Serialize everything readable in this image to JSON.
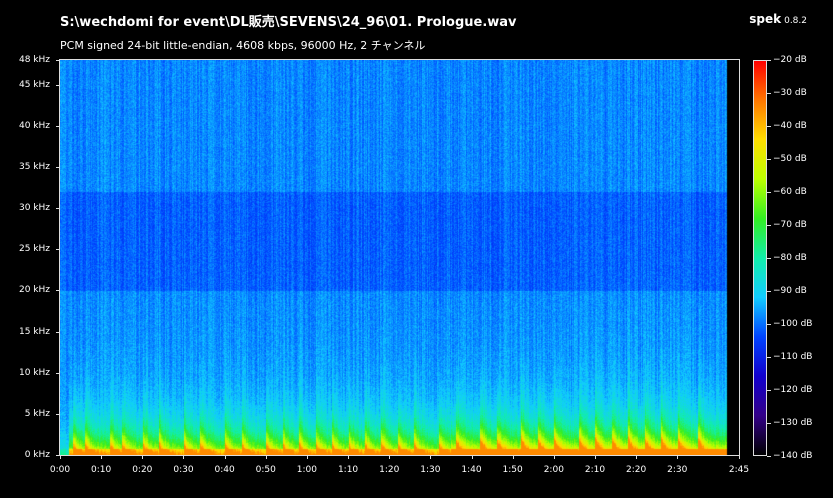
{
  "window": {
    "file_path": "S:\\wechdomi for event\\DL販売\\SEVENS\\24_96\\01. Prologue.wav",
    "file_info": "PCM signed 24-bit little-endian, 4608 kbps, 96000 Hz, 2 チャンネル",
    "app_name": "spek",
    "app_version": "0.8.2"
  },
  "spectrogram": {
    "freq_labels": [
      {
        "khz": 48,
        "label": "48 kHz"
      },
      {
        "khz": 45,
        "label": "45 kHz"
      },
      {
        "khz": 40,
        "label": "40 kHz"
      },
      {
        "khz": 35,
        "label": "35 kHz"
      },
      {
        "khz": 30,
        "label": "30 kHz"
      },
      {
        "khz": 25,
        "label": "25 kHz"
      },
      {
        "khz": 20,
        "label": "20 kHz"
      },
      {
        "khz": 15,
        "label": "15 kHz"
      },
      {
        "khz": 10,
        "label": "10 kHz"
      },
      {
        "khz": 5,
        "label": "5 kHz"
      },
      {
        "khz": 0,
        "label": "0 kHz"
      }
    ],
    "max_khz": 48,
    "duration_s": 165,
    "time_labels": [
      {
        "s": 0,
        "label": "0:00"
      },
      {
        "s": 10,
        "label": "0:10"
      },
      {
        "s": 20,
        "label": "0:20"
      },
      {
        "s": 30,
        "label": "0:30"
      },
      {
        "s": 40,
        "label": "0:40"
      },
      {
        "s": 50,
        "label": "0:50"
      },
      {
        "s": 60,
        "label": "1:00"
      },
      {
        "s": 70,
        "label": "1:10"
      },
      {
        "s": 80,
        "label": "1:20"
      },
      {
        "s": 90,
        "label": "1:30"
      },
      {
        "s": 100,
        "label": "1:40"
      },
      {
        "s": 110,
        "label": "1:50"
      },
      {
        "s": 120,
        "label": "2:00"
      },
      {
        "s": 130,
        "label": "2:10"
      },
      {
        "s": 140,
        "label": "2:20"
      },
      {
        "s": 150,
        "label": "2:30"
      },
      {
        "s": 165,
        "label": "2:45"
      }
    ]
  },
  "colorbar": {
    "db_min": -140,
    "db_max": -20,
    "labels": [
      {
        "db": -20,
        "label": "−20 dB"
      },
      {
        "db": -30,
        "label": "−30 dB"
      },
      {
        "db": -40,
        "label": "−40 dB"
      },
      {
        "db": -50,
        "label": "−50 dB"
      },
      {
        "db": -60,
        "label": "−60 dB"
      },
      {
        "db": -70,
        "label": "−70 dB"
      },
      {
        "db": -80,
        "label": "−80 dB"
      },
      {
        "db": -90,
        "label": "−90 dB"
      },
      {
        "db": -100,
        "label": "−100 dB"
      },
      {
        "db": -110,
        "label": "−110 dB"
      },
      {
        "db": -120,
        "label": "−120 dB"
      },
      {
        "db": -130,
        "label": "−130 dB"
      },
      {
        "db": -140,
        "label": "−140 dB"
      }
    ],
    "gradient_colors": [
      "#ff0000",
      "#ff7700",
      "#ffdd00",
      "#bbff00",
      "#33ee22",
      "#11eeaa",
      "#11ccff",
      "#0044ff",
      "#1100cc",
      "#330088",
      "#000000"
    ]
  }
}
